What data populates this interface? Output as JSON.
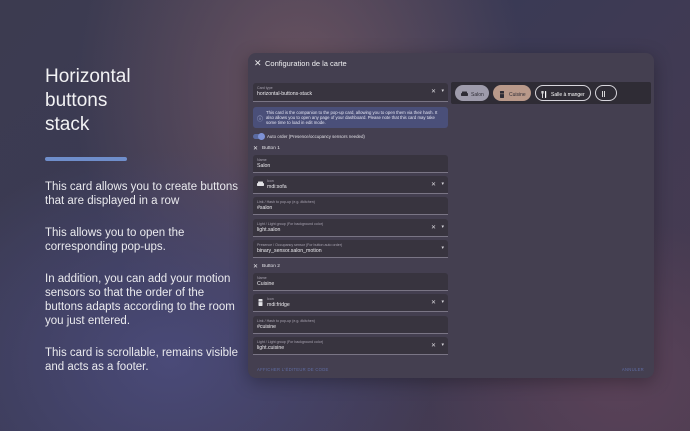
{
  "left_panel": {
    "title": "Horizontal buttons stack",
    "paragraphs": [
      "This card allows you to create buttons that are displayed in a row",
      "This allows you to open the corresponding pop-ups.",
      "In addition, you can add your motion sensors so that the order of the buttons adapts according to the room you just entered.",
      "This card is scrollable, remains visible and acts as a footer."
    ],
    "accent_color": "#6f8ecb"
  },
  "dialog": {
    "title": "Configuration de la carte",
    "close_icon": "close-icon",
    "card_type": {
      "label": "Card type",
      "value": "horizontal-buttons-stack"
    },
    "info_text": "This card is the companion to the pop-up card, allowing you to open them via their hash. It also allows you to open any page of your dashboard. Please note that this card may take some time to load in edit mode.",
    "auto_order_label": "Auto order (Presence/occupancy sensors needed)",
    "buttons": [
      {
        "section_label": "Button 1",
        "name_label": "Name",
        "name_value": "Salon",
        "icon_label": "Icon",
        "icon_value": "mdi:sofa",
        "icon": "sofa-icon",
        "link_label": "Link / Hash to pop-up (e.g. #kitchen)",
        "link_value": "#salon",
        "light_label": "Light / Light group (For background color)",
        "light_value": "light.salon",
        "presence_label": "Presence / Occupancy sensor (For button auto order)",
        "presence_value": "binary_sensor.salon_motion"
      },
      {
        "section_label": "Button 2",
        "name_label": "Name",
        "name_value": "Cuisine",
        "icon_label": "Icon",
        "icon_value": "mdi:fridge",
        "icon": "fridge-icon",
        "link_label": "Link / Hash to pop-up (e.g. #kitchen)",
        "link_value": "#cuisine",
        "light_label": "Light / Light group (For background color)",
        "light_value": "light.cuisine"
      }
    ],
    "preview": {
      "chips": [
        {
          "label": "Salon",
          "icon": "sofa-icon"
        },
        {
          "label": "Cuisine",
          "icon": "fridge-icon"
        },
        {
          "label": "Salle à manger",
          "icon": "silverware-icon"
        },
        {
          "label": "",
          "icon": "more-icon"
        }
      ]
    },
    "footer": {
      "left": "AFFICHER L'ÉDITEUR DE CODE",
      "right": "ANNULER"
    },
    "colors": {
      "dialog_bg": "#443f50",
      "field_bg": "#38343f",
      "info_bg": "#4a4f79",
      "link_accent": "#5f6ca3"
    }
  }
}
